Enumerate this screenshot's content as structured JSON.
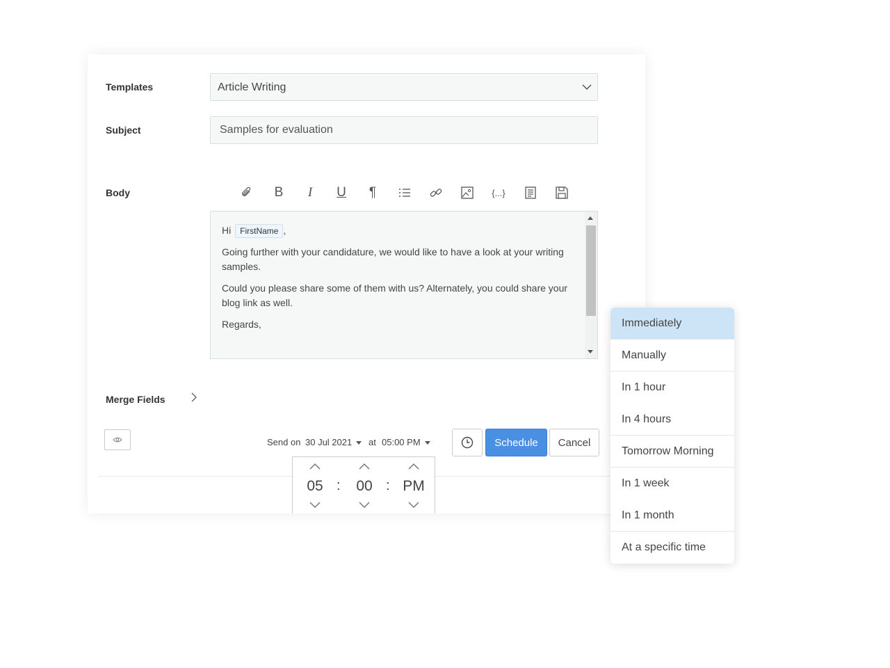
{
  "form": {
    "templates_label": "Templates",
    "templates_value": "Article Writing",
    "subject_label": "Subject",
    "subject_value": "Samples for evaluation",
    "body_label": "Body",
    "merge_fields_label": "Merge Fields"
  },
  "toolbar": {
    "icons": [
      "paperclip-icon",
      "bold-icon",
      "italic-icon",
      "underline-icon",
      "paragraph-icon",
      "list-icon",
      "link-icon",
      "image-icon",
      "code-icon",
      "template-icon",
      "save-icon"
    ],
    "bold": "B",
    "italic": "I",
    "underline": "U",
    "paragraph": "¶",
    "code": "{...}"
  },
  "body": {
    "greeting": "Hi",
    "merge_chip": "FirstName",
    "greeting_suffix": ",",
    "para1": "Going further with your candidature, we would like to have a look at your writing samples.",
    "para2": "Could you please share some of them with us? Alternately, you could share your blog link as well.",
    "sign_off": "Regards,"
  },
  "send": {
    "send_on_label": "Send on",
    "date": "30 Jul 2021",
    "at_label": "at",
    "time": "05:00 PM",
    "schedule_label": "Schedule",
    "cancel_label": "Cancel"
  },
  "time_picker": {
    "hour": "05",
    "minute": "00",
    "period": "PM",
    "separator": ":"
  },
  "schedule_menu": {
    "selected": "Immediately",
    "items": [
      "Immediately",
      "Manually",
      "In 1 hour",
      "In 4 hours",
      "Tomorrow Morning",
      "In 1 week",
      "In 1 month",
      "At a specific time"
    ]
  },
  "colors": {
    "primary": "#4a90e2",
    "selected_item": "#cde3f6"
  }
}
